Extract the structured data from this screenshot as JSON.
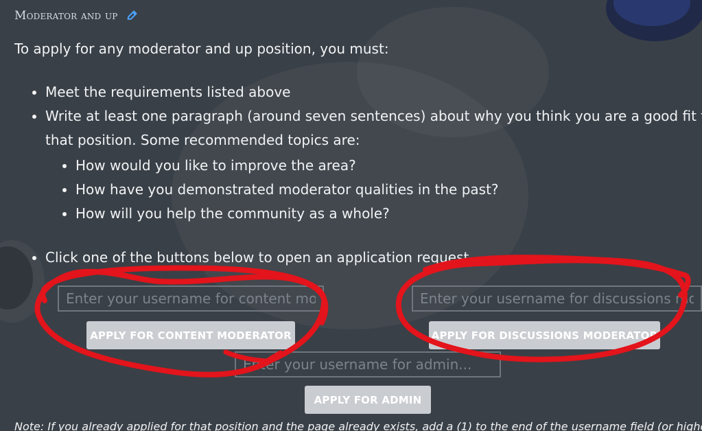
{
  "section": {
    "title": "Moderator and up",
    "edit_icon": "pencil-icon"
  },
  "content": {
    "intro": "To apply for any moderator and up position, you must:",
    "requirements": [
      "Meet the requirements listed above",
      "Write at least one paragraph (around seven sentences) about why you think you are a good fit for that position. Some recommended topics are:"
    ],
    "topics": [
      "How would you like to improve the area?",
      "How have you demonstrated moderator qualities in the past?",
      "How will you help the community as a whole?"
    ],
    "click_instruction": "Click one of the buttons below to open an application request"
  },
  "forms": {
    "content_moderator": {
      "placeholder": "Enter your username for content mod...",
      "button_label": "Apply for content moderator"
    },
    "discussions_moderator": {
      "placeholder": "Enter your username for discussions mo",
      "button_label": "Apply for discussions moderator"
    },
    "admin": {
      "placeholder": "Enter your username for admin...",
      "button_label": "Apply for admin"
    }
  },
  "note": {
    "text": "Note: If you already applied for that position and the page already exists, add a (1) to the end of the username field (or higher if"
  },
  "colors": {
    "background": "#3a4047",
    "text": "#f1f3f5",
    "button_background": "#c9ccd1",
    "input_border": "#70767d",
    "annotation": "#e3141b",
    "edit_icon": "#4ba4ff"
  }
}
